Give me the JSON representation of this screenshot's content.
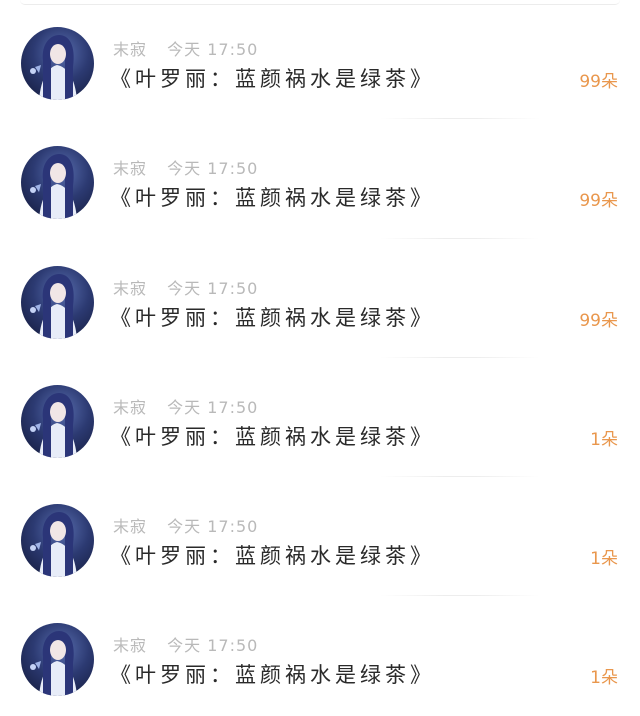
{
  "messages": [
    {
      "author": "末寂",
      "date": "今天",
      "time": "17:50",
      "title": "《叶罗丽：蓝颜祸水是绿茶》",
      "flowers": "99朵"
    },
    {
      "author": "末寂",
      "date": "今天",
      "time": "17:50",
      "title": "《叶罗丽：蓝颜祸水是绿茶》",
      "flowers": "99朵"
    },
    {
      "author": "末寂",
      "date": "今天",
      "time": "17:50",
      "title": "《叶罗丽：蓝颜祸水是绿茶》",
      "flowers": "99朵"
    },
    {
      "author": "末寂",
      "date": "今天",
      "time": "17:50",
      "title": "《叶罗丽：蓝颜祸水是绿茶》",
      "flowers": "1朵"
    },
    {
      "author": "末寂",
      "date": "今天",
      "time": "17:50",
      "title": "《叶罗丽：蓝颜祸水是绿茶》",
      "flowers": "1朵"
    },
    {
      "author": "末寂",
      "date": "今天",
      "time": "17:50",
      "title": "《叶罗丽：蓝颜祸水是绿茶》",
      "flowers": "1朵"
    }
  ],
  "colors": {
    "flowers": "#e9974d",
    "meta": "#b9b9b9",
    "title": "#2a2a2a"
  },
  "icons": {
    "avatar": "anime-character-avatar"
  }
}
